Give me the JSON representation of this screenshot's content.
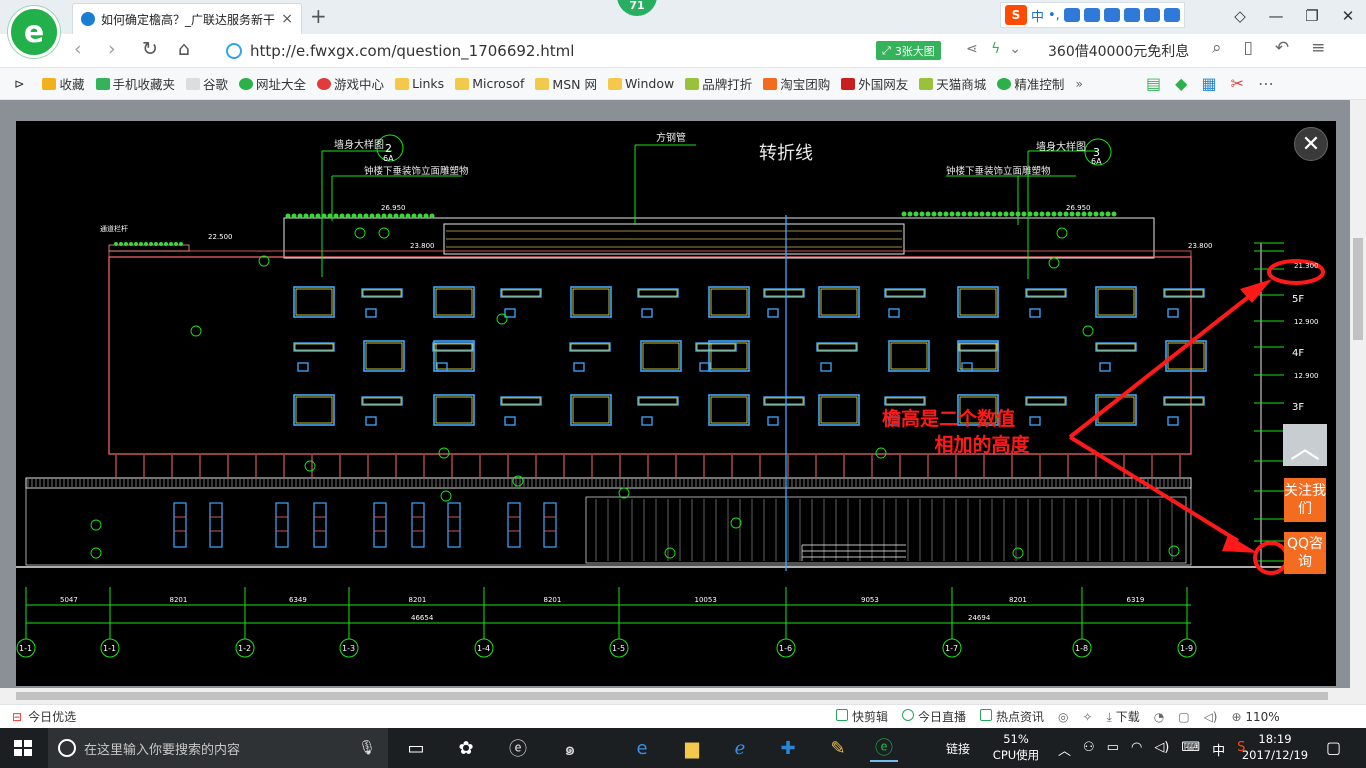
{
  "tab": {
    "title": "如何确定檐高？_广联达服务新干线",
    "close": "×",
    "new": "+"
  },
  "logo": {
    "letter": "e"
  },
  "badge": {
    "count": "71"
  },
  "sogou": {
    "mode": "中",
    "punct": "•,"
  },
  "window": {
    "minimize": "—",
    "restore": "❐",
    "close": "✕"
  },
  "nav": {
    "url": "http://e.fwxgx.com/question_1706692.html",
    "big_image": "3张大图",
    "promo": "360借40000元免利息"
  },
  "bookmarks": [
    "收藏",
    "手机收藏夹",
    "谷歌",
    "网址大全",
    "游戏中心",
    "Links",
    "Microsof",
    "MSN 网",
    "Window",
    "品牌打折",
    "淘宝团购",
    "外国网友",
    "天猫商城",
    "精准控制"
  ],
  "bookmark_more": "»",
  "drawing": {
    "title": "转折线",
    "label_pipe": "方钢管",
    "label_left": "墙身大样图",
    "label_right": "墙身大样图",
    "note_left": "钟楼下垂装饰立面雕塑物",
    "note_right": "钟楼下垂装饰立面雕塑物",
    "bubble_left": "2",
    "bubble_right": "3",
    "sheet": "6A",
    "elev_top": "26.950",
    "elev_roof": "23.800",
    "elev_parapet": "22.500",
    "floors": [
      "5F",
      "4F",
      "3F"
    ],
    "elev_5f": "21.300",
    "elev_4f": "12.900",
    "elev_3f": "12.900",
    "dims": [
      "5047",
      "8201",
      "6349",
      "8201",
      "8201",
      "10053",
      "9053",
      "8201",
      "6319"
    ],
    "dims_total": [
      "46654",
      "24694"
    ],
    "axes": [
      "1-1",
      "1-2",
      "1-3",
      "1-4",
      "1-5",
      "1-6",
      "1-7",
      "1-8",
      "1-9"
    ],
    "first_axis": "1-1",
    "rail_label": "通道栏杆"
  },
  "annotation": {
    "line1": "檐高是二个数值",
    "line2": "相加的高度"
  },
  "side": {
    "close": "✕",
    "totop": "︿",
    "follow": "关注我们",
    "qq": "QQ咨询"
  },
  "statusbar": {
    "left": "今日优选",
    "items": [
      "快剪辑",
      "今日直播",
      "热点资讯",
      "下载"
    ],
    "zoom": "110%"
  },
  "taskbar": {
    "search_placeholder": "在这里输入你要搜索的内容",
    "link_label": "链接",
    "cpu_percent": "51%",
    "cpu_label": "CPU使用",
    "ime": "中",
    "time": "18:19",
    "date": "2017/12/19"
  },
  "colors": {
    "accent": "#22b04b",
    "annotation": "#ff1a1a",
    "orange": "#f46c1f"
  }
}
